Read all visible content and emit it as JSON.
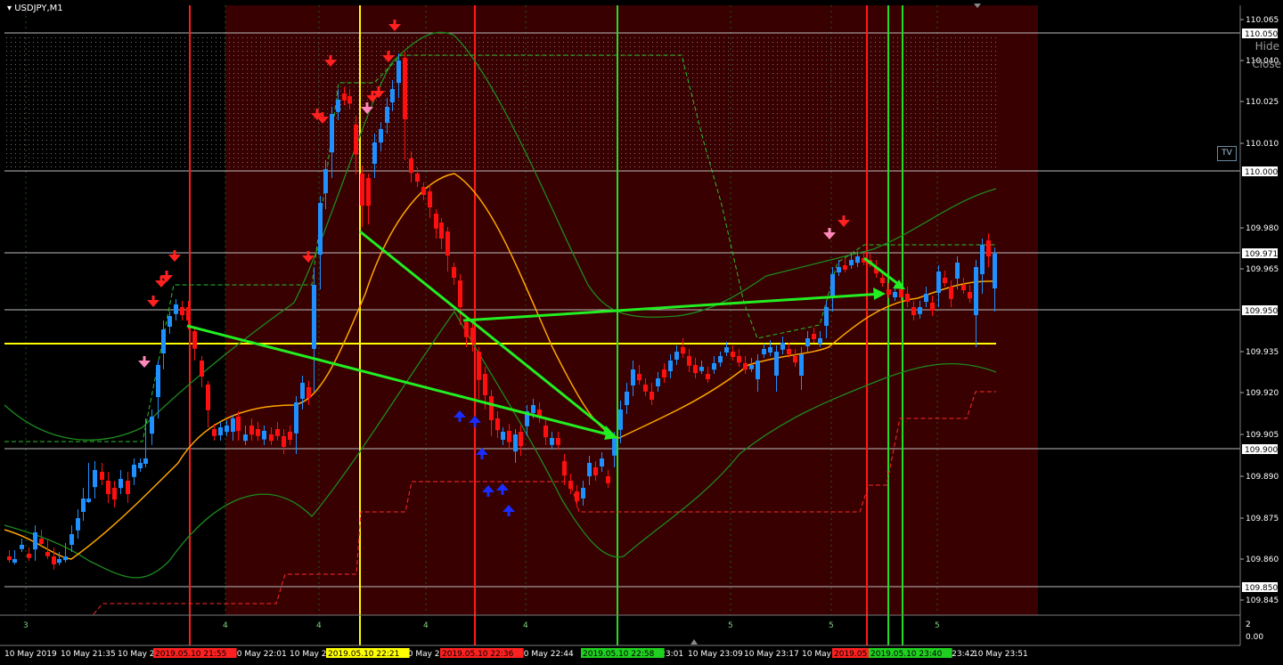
{
  "window": {
    "symbol_title": "USDJPY,M1",
    "hide_label": "Hide",
    "close_label": "Close",
    "tv_label": "TV"
  },
  "price_axis": {
    "ticks": [
      "110.065",
      "110.040",
      "110.025",
      "110.010",
      "109.980",
      "109.965",
      "109.935",
      "109.920",
      "109.905",
      "109.890",
      "109.875",
      "109.860",
      "109.845"
    ],
    "highlighted": [
      "110.050",
      "110.000",
      "109.971",
      "109.950",
      "109.900",
      "109.850"
    ]
  },
  "sub_panel": {
    "labels": [
      "3",
      "4",
      "4",
      "4",
      "4",
      "5",
      "5",
      "5"
    ],
    "axis_top": "2",
    "axis_bottom": "0.00"
  },
  "time_axis": {
    "labels": [
      "10 May 2019",
      "10 May 21:35",
      "10 May 2",
      "10 May 22:01",
      "10 May 2",
      "10 May 2",
      "10 May 22:44",
      "y 23:01",
      "10 May 23:09",
      "10 May 23:17",
      "10 May",
      "y 23:42",
      "10 May 23:51"
    ],
    "tags": [
      {
        "text": "2019.05.10 21:55",
        "color": "#ff2020"
      },
      {
        "text": "2019.05.10 22:21",
        "color": "#ffff00"
      },
      {
        "text": "2019.05.10 22:36",
        "color": "#ff2020"
      },
      {
        "text": "2019.05.10 22:58",
        "color": "#20d020"
      },
      {
        "text": "2019.05",
        "color": "#ff2020"
      },
      {
        "text": "2019.05.10 23:40",
        "color": "#20d020"
      }
    ]
  },
  "colors": {
    "bull": "#1e90ff",
    "bear": "#ff1010",
    "zone": "#3a0000",
    "band": "#1c7a1c",
    "ma": "#ffa500",
    "arrow": "#22ff22",
    "level": "#ffff00"
  }
}
